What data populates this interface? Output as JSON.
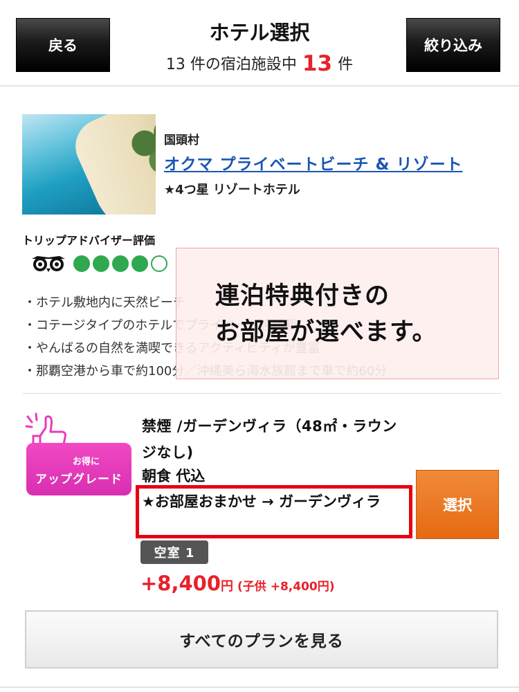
{
  "header": {
    "back_label": "戻る",
    "title": "ホテル選択",
    "count_prefix": "13 件の宿泊施設中",
    "count_value": "13",
    "count_suffix": "件",
    "filter_label": "絞り込み"
  },
  "hotel": {
    "area": "国頭村",
    "name": "オクマ プライベートビーチ & リゾート",
    "rank": "★4つ星 リゾートホテル",
    "tripadvisor_label": "トリップアドバイザー評価",
    "tripadvisor_rating": 4,
    "tripadvisor_max": 5,
    "features": [
      "ホテル敷地内に天然ビーチ",
      "コテージタイプのホテルでプライベート感満載",
      "やんばるの自然を満喫できるアクティビティが豊富",
      "那覇空港から車で約100分／沖縄美ら海水族館まで車で約60分"
    ]
  },
  "overlay": {
    "line1": "連泊特典付きの",
    "line2": "お部屋が選べます。"
  },
  "plan": {
    "badge_small": "お得に",
    "badge_big": "アップグレード",
    "room_name": "禁煙 /ガーデンヴィラ（48㎡・ラウンジなし)",
    "meal": "朝食 代込",
    "room_note": "★お部屋おまかせ → ガーデンヴィラ",
    "vacancy": "空室 1",
    "price_main": "+8,400",
    "price_yen": "円",
    "price_child": "(子供 +8,400円)",
    "select_label": "選択"
  },
  "footer": {
    "all_plans_label": "すべてのプランを見る"
  },
  "colors": {
    "accent_red": "#e8212a",
    "link_blue": "#1a56b5",
    "select_orange": "#e56a12",
    "badge_pink": "#e83bbb",
    "rating_green": "#2fa84f"
  }
}
